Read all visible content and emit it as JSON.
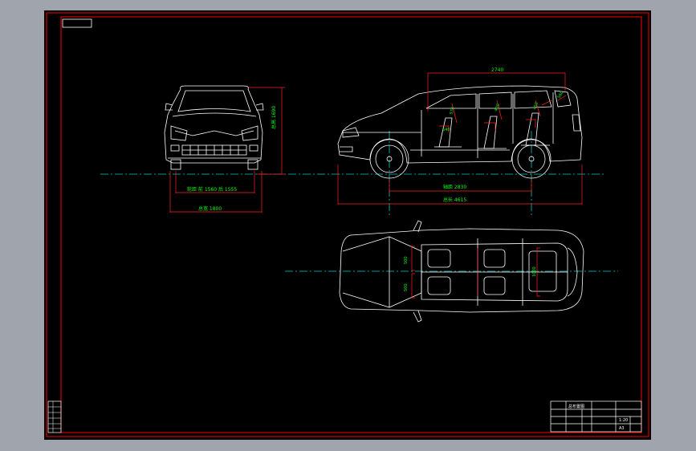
{
  "drawing": {
    "background": "#000000",
    "frame_color": "#ff0000",
    "outline_color": "#ffffff",
    "centerline_color": "#00c8c8",
    "dimension_line_color": "#ff2020",
    "dimension_text_color": "#00ff00"
  },
  "front_view": {
    "height_label": "总高 1690",
    "track_label": "轮距 前 1560 后 1555",
    "width_label": "总宽 1800"
  },
  "side_view": {
    "top_label": "2740",
    "wheelbase_label": "轴距 2830",
    "length_label": "总长 4615",
    "seat_labels": [
      "570",
      "540",
      "400",
      "450",
      "560"
    ]
  },
  "top_view": {
    "seat_widths": [
      "500",
      "500",
      "1000"
    ]
  },
  "title_block": {
    "drawing_title": "总布置图",
    "sheet_label": "1:20",
    "scale_label": "A3"
  }
}
